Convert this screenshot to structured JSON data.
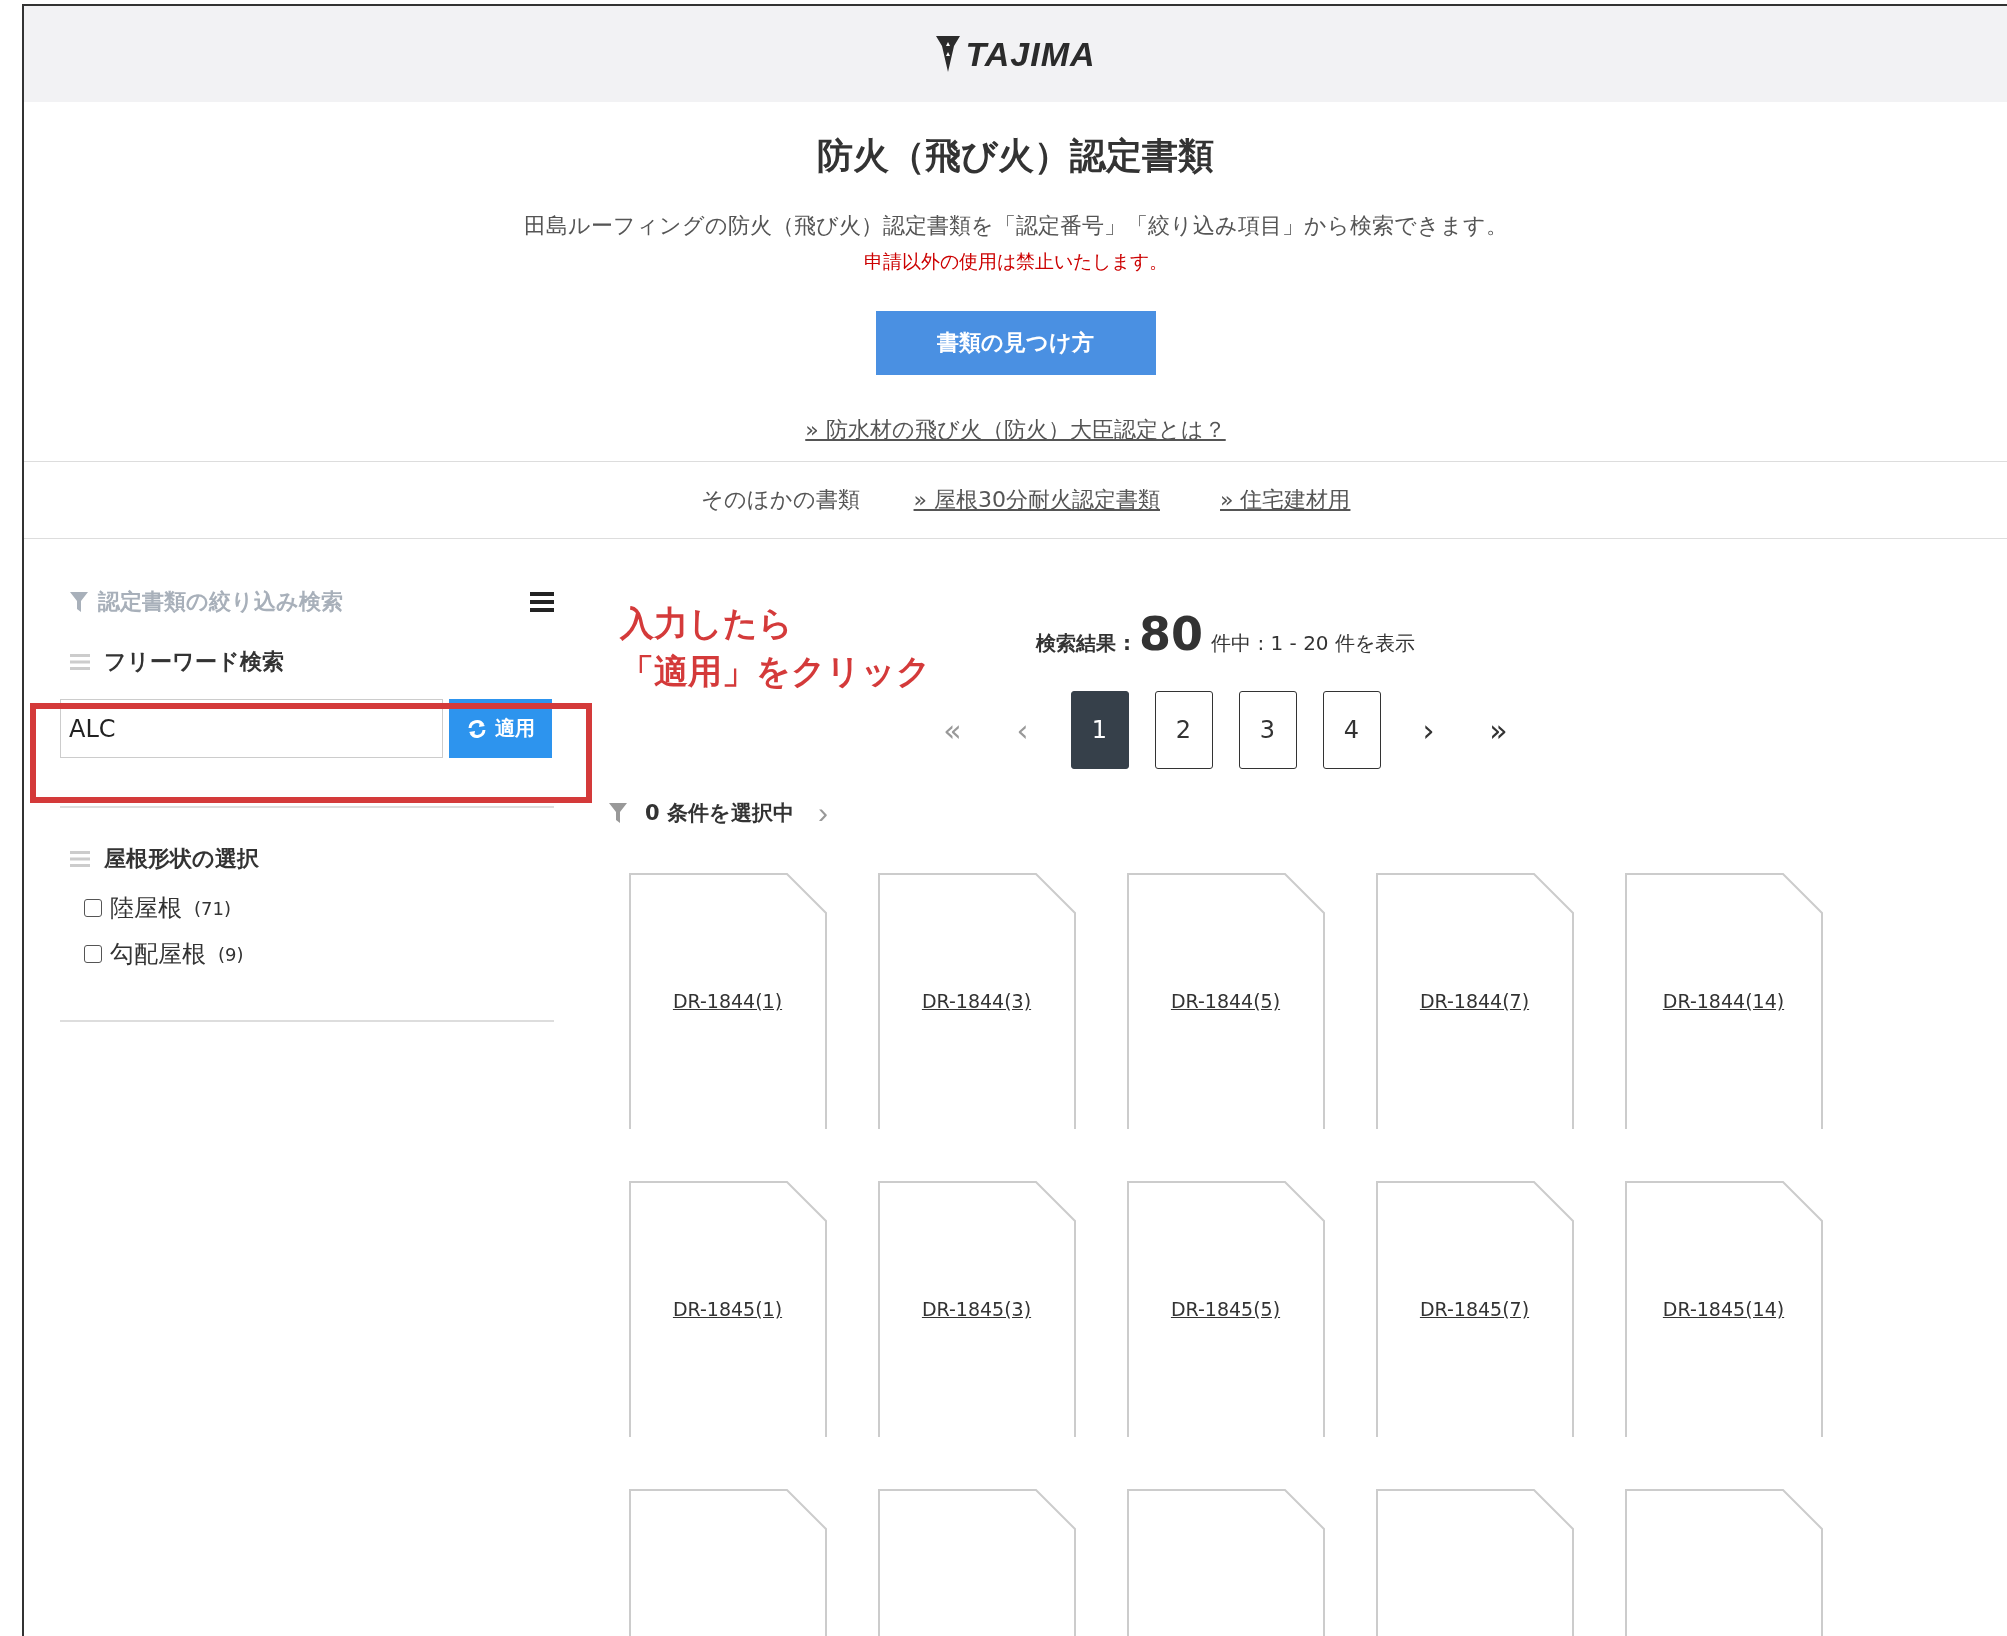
{
  "header": {
    "logo": "TAJIMA"
  },
  "intro": {
    "title": "防火（飛び火）認定書類",
    "description": "田島ルーフィングの防火（飛び火）認定書類を「認定番号」「絞り込み項目」から検索できます。",
    "notice": "申請以外の使用は禁止いたします。",
    "guide_button": "書類の見つけ方",
    "link": "» 防水材の飛び火（防火）大臣認定とは？"
  },
  "other_docs": {
    "label": "そのほかの書類",
    "links": [
      "» 屋根30分耐火認定書類",
      "» 住宅建材用"
    ]
  },
  "sidebar": {
    "title": "認定書類の絞り込み検索",
    "freeword": {
      "heading": "フリーワード検索",
      "value": "ALC",
      "apply_button": "適用"
    },
    "roof_shape": {
      "heading": "屋根形状の選択",
      "options": [
        {
          "label": "陸屋根",
          "count": "(71)",
          "checked": false
        },
        {
          "label": "勾配屋根",
          "count": "(9)",
          "checked": false
        }
      ]
    }
  },
  "annotation": {
    "lines": [
      "入力したら",
      "「適用」をクリック"
    ]
  },
  "results": {
    "prefix": "検索結果 :",
    "total": "80",
    "suffix": "件中 : 1 - 20 件を表示"
  },
  "pagination": {
    "first": "«",
    "prev": "‹",
    "pages": [
      {
        "label": "1",
        "selected": true
      },
      {
        "label": "2",
        "selected": false
      },
      {
        "label": "3",
        "selected": false
      },
      {
        "label": "4",
        "selected": false
      }
    ],
    "next": "›",
    "last": "»"
  },
  "filter_status": {
    "text": "0 条件を選択中",
    "chevron": "›"
  },
  "documents": [
    {
      "label": "DR-1844(1)"
    },
    {
      "label": "DR-1844(3)"
    },
    {
      "label": "DR-1844(5)"
    },
    {
      "label": "DR-1844(7)"
    },
    {
      "label": "DR-1844(14)"
    },
    {
      "label": "DR-1845(1)"
    },
    {
      "label": "DR-1845(3)"
    },
    {
      "label": "DR-1845(5)"
    },
    {
      "label": "DR-1845(7)"
    },
    {
      "label": "DR-1845(14)"
    }
  ]
}
